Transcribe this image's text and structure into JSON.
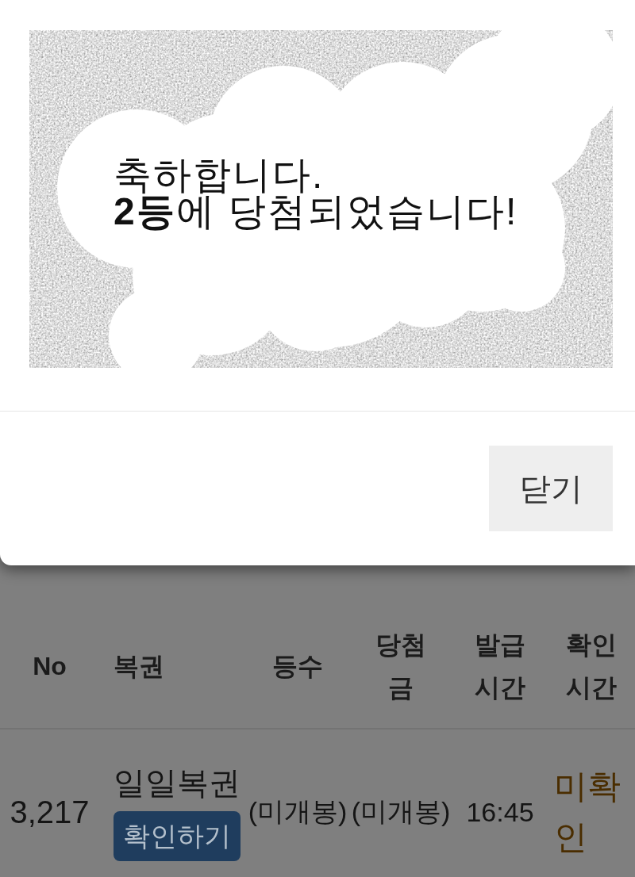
{
  "dialog": {
    "message_lines": [
      "축하합니다.",
      "**2등**에 당첨되었습니다!"
    ],
    "close_button": "닫기"
  },
  "table": {
    "columns": [
      "No",
      "복권",
      "등수",
      "당첨금",
      "발급시간",
      "확인시간"
    ],
    "rows": [
      {
        "no": "3,217",
        "lottery": "일일복권",
        "action": "확인하기",
        "rank": "(미개봉)",
        "prize": "(미개봉)",
        "issued_time": "16:45",
        "confirmed_time": "미확인",
        "confirmed": false
      }
    ]
  }
}
